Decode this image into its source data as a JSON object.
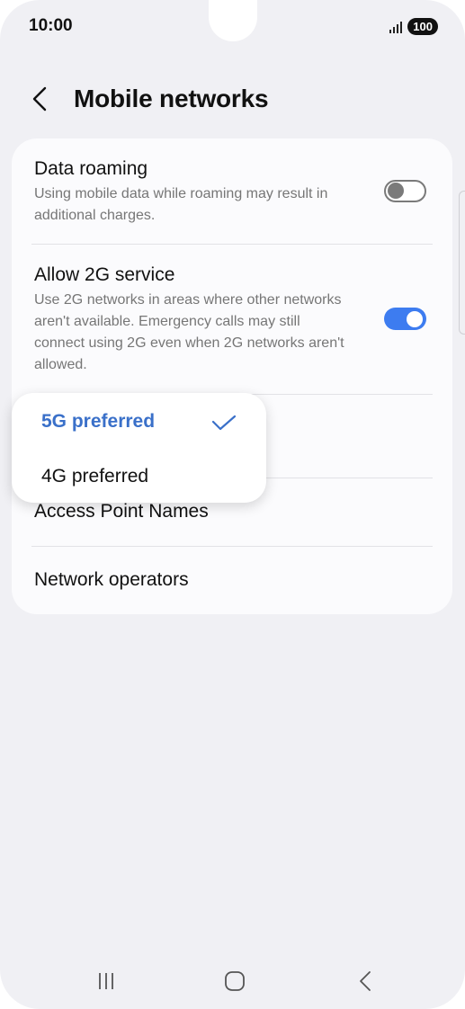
{
  "status_bar": {
    "time": "10:00",
    "battery": "100"
  },
  "header": {
    "title": "Mobile networks"
  },
  "settings": {
    "data_roaming": {
      "title": "Data roaming",
      "description": "Using mobile data while roaming may result in additional charges.",
      "enabled": false
    },
    "allow_2g": {
      "title": "Allow 2G service",
      "description": "Use 2G networks in areas where other networks aren't available. Emergency calls may still connect using 2G even when 2G networks aren't allowed.",
      "enabled": true
    },
    "access_point_names": {
      "title": "Access Point Names"
    },
    "network_operators": {
      "title": "Network operators"
    }
  },
  "network_mode_popup": {
    "options": [
      {
        "label": "5G preferred",
        "selected": true
      },
      {
        "label": "4G preferred",
        "selected": false
      }
    ]
  },
  "colors": {
    "accent": "#3a70c9",
    "toggle_on": "#3d7cf0",
    "background": "#f0f0f4"
  },
  "nav_bar": {
    "icons": [
      "recents-icon",
      "home-icon",
      "back-icon"
    ]
  }
}
